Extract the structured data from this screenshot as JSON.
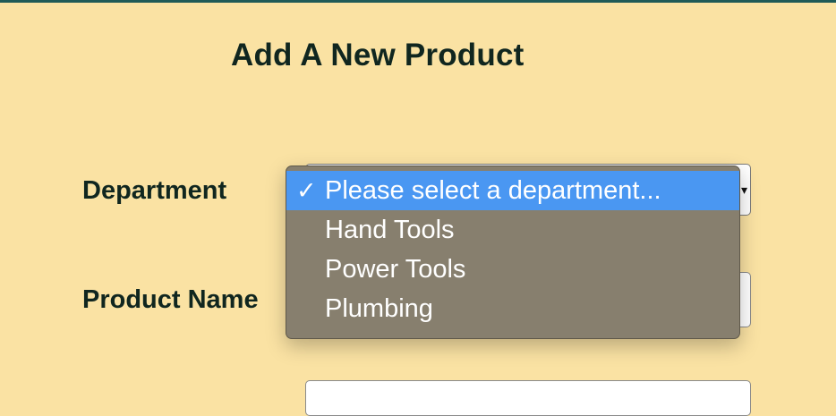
{
  "page": {
    "title": "Add A New Product"
  },
  "form": {
    "department_label": "Department",
    "product_name_label": "Product Name"
  },
  "department_select": {
    "selected_value": "Please select a department...",
    "options": [
      {
        "label": "Please select a department...",
        "selected": true
      },
      {
        "label": "Hand Tools",
        "selected": false
      },
      {
        "label": "Power Tools",
        "selected": false
      },
      {
        "label": "Plumbing",
        "selected": false
      }
    ]
  },
  "icons": {
    "check": "check-icon",
    "caret": "chevron-down-icon"
  },
  "colors": {
    "background": "#fae2a3",
    "text": "#10261f",
    "dropdown_bg": "#877f6e",
    "highlight": "#4a97f2",
    "top_rule": "#1f5a57"
  }
}
